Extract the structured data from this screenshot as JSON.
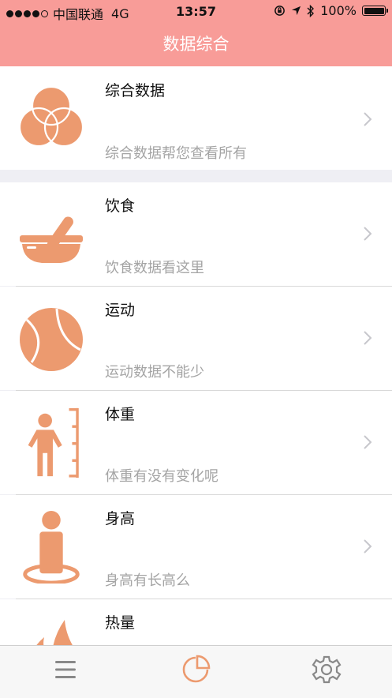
{
  "status_bar": {
    "carrier": "中国联通",
    "network": "4G",
    "time": "13:57",
    "battery": "100%"
  },
  "nav": {
    "title": "数据综合"
  },
  "summary": {
    "title": "综合数据",
    "subtitle": "综合数据帮您查看所有",
    "icon": "venn-circles-icon"
  },
  "items": [
    {
      "title": "饮食",
      "subtitle": "饮食数据看这里",
      "icon": "mortar-pestle-icon"
    },
    {
      "title": "运动",
      "subtitle": "运动数据不能少",
      "icon": "tennis-ball-icon"
    },
    {
      "title": "体重",
      "subtitle": "体重有没有变化呢",
      "icon": "person-ruler-icon"
    },
    {
      "title": "身高",
      "subtitle": "身高有长高么",
      "icon": "person-standing-icon"
    },
    {
      "title": "热量",
      "subtitle": "",
      "icon": "flame-icon"
    }
  ],
  "tabbar": {
    "tabs": [
      "menu-icon",
      "pie-chart-icon",
      "gear-icon"
    ],
    "active": "pie-chart-icon"
  },
  "colors": {
    "accent": "#f89c98",
    "icon": "#ec9a6f"
  }
}
